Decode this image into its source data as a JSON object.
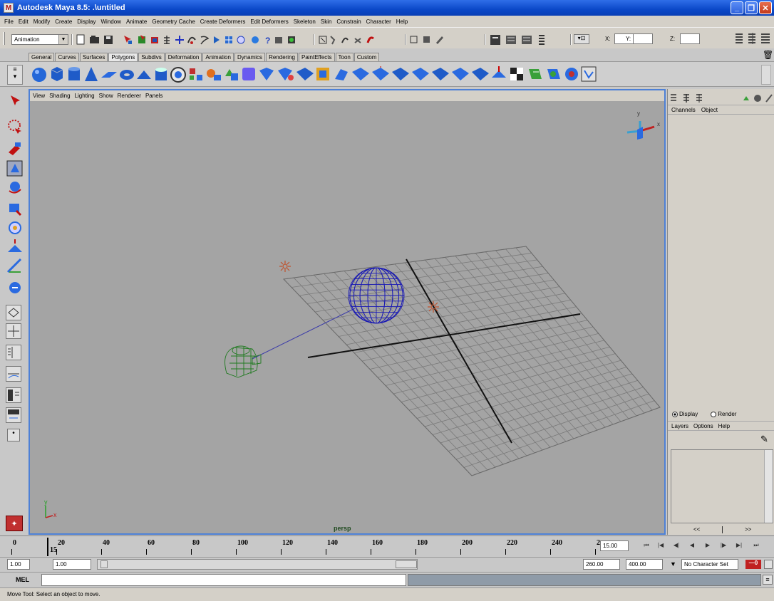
{
  "window": {
    "title": "Autodesk Maya 8.5: .\\untitled",
    "app_icon": "maya-icon",
    "buttons": [
      "minimize-icon",
      "restore-icon",
      "close-icon"
    ]
  },
  "menu": [
    "File",
    "Edit",
    "Modify",
    "Create",
    "Display",
    "Window",
    "Animate",
    "Geometry Cache",
    "Create Deformers",
    "Edit Deformers",
    "Skeleton",
    "Skin",
    "Constrain",
    "Character",
    "Help"
  ],
  "status_line": {
    "mode": "Animation",
    "x_label": "X:",
    "y_label": "Y:",
    "z_label": "Z:"
  },
  "shelf_tabs": [
    "General",
    "Curves",
    "Surfaces",
    "Polygons",
    "Subdivs",
    "Deformation",
    "Animation",
    "Dynamics",
    "Rendering",
    "PaintEffects",
    "Toon",
    "Custom"
  ],
  "active_shelf_tab": "Polygons",
  "viewport": {
    "menu": [
      "View",
      "Shading",
      "Lighting",
      "Show",
      "Renderer",
      "Panels"
    ],
    "camera_name": "persp",
    "axis_x": "x",
    "axis_y": "y",
    "axis_z": "z",
    "gizmo_x": "x"
  },
  "channel_box": {
    "headers": [
      "Channels",
      "Object"
    ]
  },
  "layer_editor": {
    "display_label": "Display",
    "render_label": "Render",
    "menu": [
      "Layers",
      "Options",
      "Help"
    ],
    "nav_prev": "<<",
    "nav_next": ">>"
  },
  "time_slider": {
    "ticks": [
      "0",
      "20",
      "40",
      "60",
      "80",
      "100",
      "120",
      "140",
      "160",
      "180",
      "200",
      "220",
      "240",
      "2"
    ],
    "current_frame_marker": "15",
    "current_time": "15.00"
  },
  "range_slider": {
    "start_time": "1.00",
    "playback_start": "1.00",
    "playback_end": "260.00",
    "end_time": "400.00",
    "character_set": "No Character Set"
  },
  "command_line": {
    "label": "MEL",
    "value": ""
  },
  "help_line": {
    "text": "Move Tool: Select an object to move."
  },
  "colors": {
    "title_blue": "#0b48c8",
    "viewport_bg": "#a4a4a4",
    "viewport_border": "#4d80d6",
    "wire_sphere": "#1a1ab4",
    "wire_camera": "#1f7a1f",
    "light_marker": "#c0502a"
  }
}
